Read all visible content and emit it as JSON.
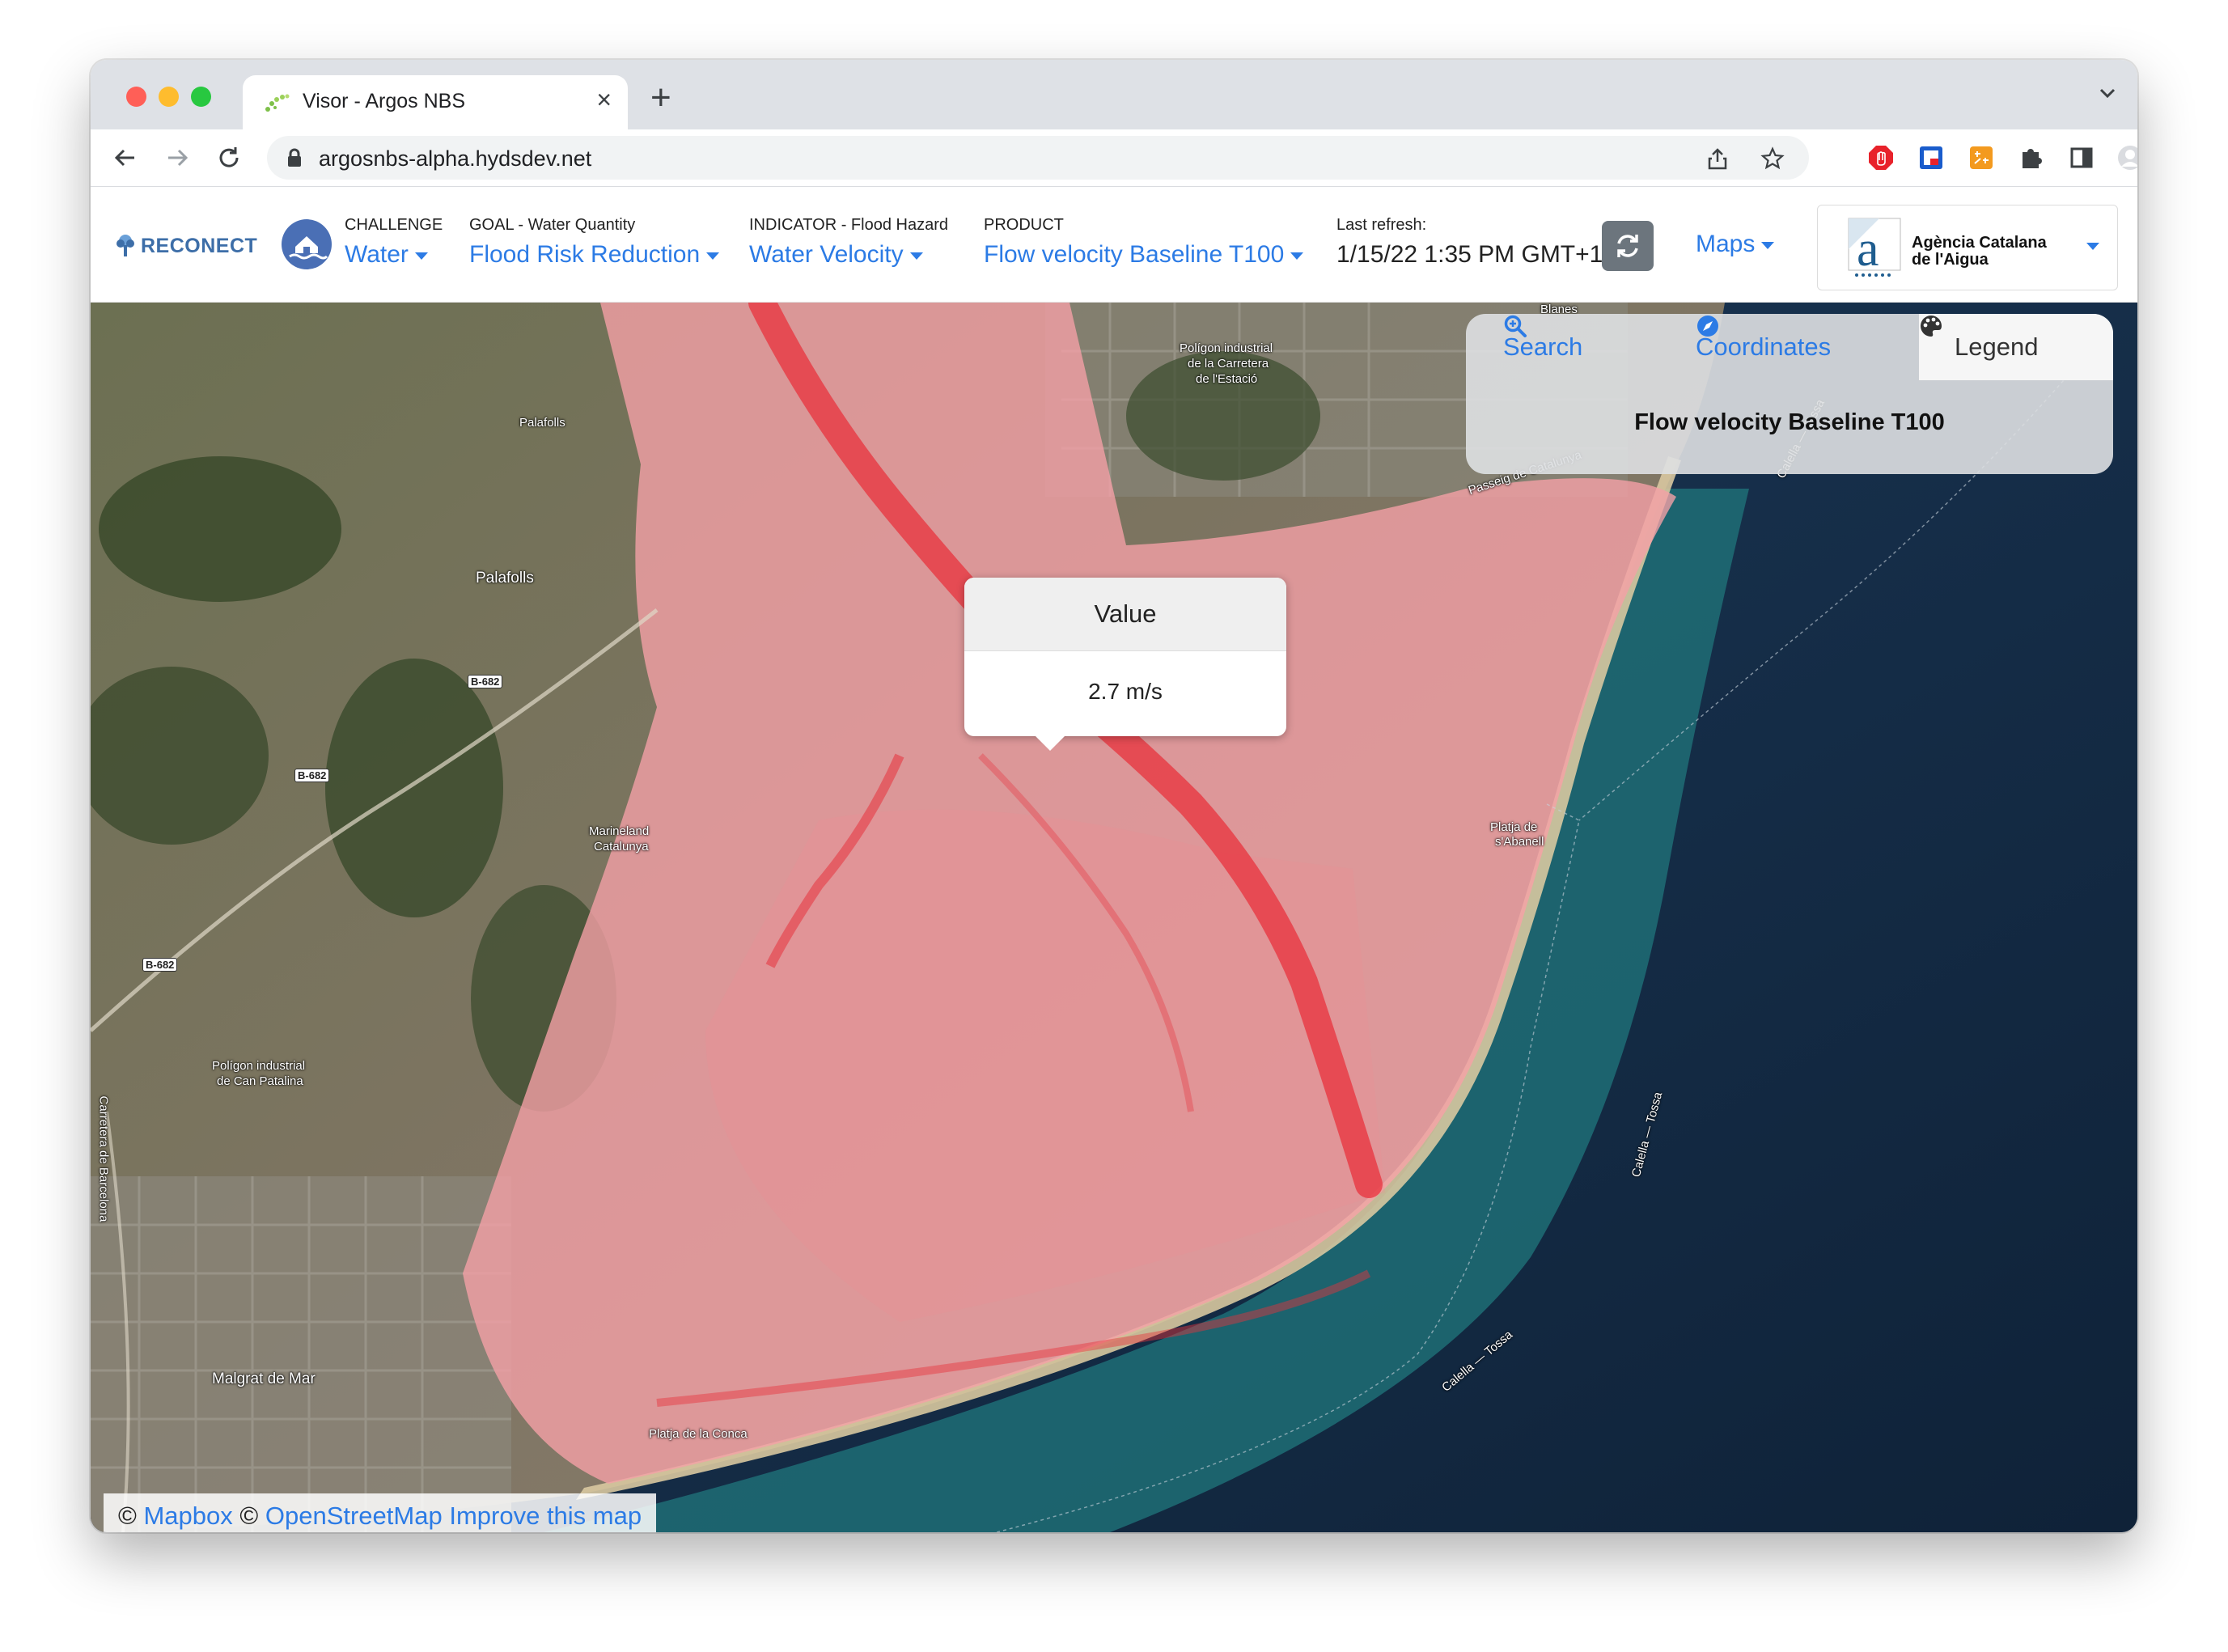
{
  "browser": {
    "tab_title": "Visor - Argos NBS",
    "url": "argosnbs-alpha.hydsdev.net",
    "tab_close": "×",
    "new_tab": "+"
  },
  "header": {
    "logo_text": "RECONECT",
    "challenge": {
      "label": "CHALLENGE",
      "value": "Water"
    },
    "goal": {
      "label": "GOAL - Water Quantity",
      "value": "Flood Risk Reduction"
    },
    "indicator": {
      "label": "INDICATOR - Flood Hazard",
      "value": "Water Velocity"
    },
    "product": {
      "label": "PRODUCT",
      "value": "Flow velocity Baseline T100"
    },
    "refresh": {
      "label": "Last refresh:",
      "value": "1/15/22 1:35 PM GMT+1"
    },
    "maps_label": "Maps",
    "org_name_line1": "Agència Catalana",
    "org_name_line2": "de l'Aigua"
  },
  "panel": {
    "tabs": {
      "search": "Search",
      "coordinates": "Coordinates",
      "legend": "Legend"
    },
    "active_tab": "legend",
    "title": "Flow velocity Baseline T100"
  },
  "tooltip": {
    "header": "Value",
    "value": "2.7 m/s"
  },
  "map_labels": {
    "palafolls": "Palafolls",
    "palafolls_small": "Palafolls",
    "malgrat": "Malgrat de Mar",
    "poligon_can_patalina_1": "Polígon industrial",
    "poligon_can_patalina_2": "de Can Patalina",
    "poligon_carretera_1": "Polígon industrial",
    "poligon_carretera_2": "de la Carretera",
    "poligon_carretera_3": "de l'Estació",
    "marineland_1": "Marineland",
    "marineland_2": "Catalunya",
    "passeig": "Passeig de Catalunya",
    "calella_tossa": "Calella — Tossa",
    "blanes": "Blanes",
    "platja_conca": "Platja de la Conca",
    "carretera_barcelona": "Carretera de Barcelona",
    "platja_abanell_1": "Platja de",
    "platja_abanell_2": "s'Abanell",
    "b682": "B-682"
  },
  "attribution": {
    "mapbox": "Mapbox",
    "osm": "OpenStreetMap",
    "improve": "Improve this map",
    "copyright": "©"
  },
  "colors": {
    "accent": "#2c7be5",
    "flood_overlay": "#f4a0a6",
    "flood_high": "#e8323c",
    "sea": "#1a3350",
    "coast": "#1e6d76"
  }
}
